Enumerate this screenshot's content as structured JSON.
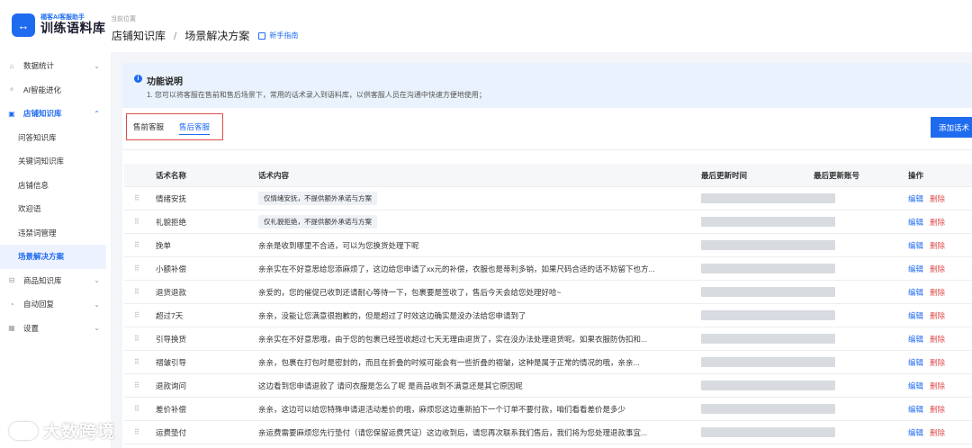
{
  "brand": {
    "subtitle": "福客AI客服助手",
    "title": "训练语料库"
  },
  "sidebar": {
    "items": [
      {
        "name": "nav-data-stats",
        "label": "数据统计",
        "icon": "home-icon",
        "glyph": "⌂",
        "chevron": "⌄"
      },
      {
        "name": "nav-ai-evolution",
        "label": "AI智能进化",
        "icon": "magic-wand-icon",
        "glyph": "✧",
        "chevron": ""
      },
      {
        "name": "nav-store-kb",
        "label": "店铺知识库",
        "icon": "book-icon",
        "glyph": "▣",
        "chevron": "⌃"
      },
      {
        "name": "nav-product-kb",
        "label": "商品知识库",
        "icon": "box-icon",
        "glyph": "⊟",
        "chevron": "⌄"
      },
      {
        "name": "nav-auto-reply",
        "label": "自动回复",
        "icon": "robot-icon",
        "glyph": "◔",
        "chevron": "⌄"
      },
      {
        "name": "nav-settings",
        "label": "设置",
        "icon": "grid-icon",
        "glyph": "▦",
        "chevron": "⌄"
      }
    ],
    "sub_items": [
      "问答知识库",
      "关键词知识库",
      "店铺信息",
      "欢迎语",
      "违禁词管理",
      "场景解决方案"
    ]
  },
  "header": {
    "caption": "当前位置",
    "crumb_root": "店铺知识库",
    "crumb_sep": "/",
    "crumb_current": "场景解决方案",
    "guide_link": "新手指南"
  },
  "info": {
    "icon": "i",
    "title": "功能说明",
    "text": "1. 您可以将客服在售前和售后场景下，常用的话术录入到语料库，以供客服人员在沟通中快速方便地使用；"
  },
  "tabs": [
    {
      "label": "售前客服"
    },
    {
      "label": "售后客服"
    }
  ],
  "add_button": "添加话术",
  "table": {
    "headers": {
      "name": "话术名称",
      "content": "话术内容",
      "time": "最后更新时间",
      "account": "最后更新账号",
      "ops": "操作"
    },
    "edit_label": "编辑",
    "delete_label": "删除",
    "rows": [
      {
        "name": "情绪安抚",
        "content": "仅情绪安抚，不提供额外承诺与方案",
        "tag": true
      },
      {
        "name": "礼貌拒绝",
        "content": "仅礼貌拒绝，不提供额外承诺与方案",
        "tag": true
      },
      {
        "name": "挽单",
        "content": "亲亲是收到哪里不合适，可以为您换货处理下呢",
        "tag": false
      },
      {
        "name": "小额补偿",
        "content": "亲亲实在不好意思给您添麻烦了，这边给您申请了xx元的补偿，衣服也是蒂利多销，如果尺码合适的话不妨留下也方...",
        "tag": false
      },
      {
        "name": "退货退款",
        "content": "亲爱的，您的催促已收到还请耐心等待一下，包裹要是签收了，售后今天会给您处理好哈~",
        "tag": false
      },
      {
        "name": "超过7天",
        "content": "亲亲，没能让您满意很抱歉的，但是超过了时效这边确实是没办法给您申请到了",
        "tag": false
      },
      {
        "name": "引导换货",
        "content": "亲亲实在不好意思哦，由于您的包裹已经签收超过七天无理由退货了，实在没办法处理退货呢。如果衣服防伪扣和...",
        "tag": false
      },
      {
        "name": "褶皱引导",
        "content": "亲亲，包裹在打包时是密封的，而且在折叠的时候可能会有一些折叠的褶皱，这种是属于正常的情况的哦，亲亲...",
        "tag": false
      },
      {
        "name": "退款询问",
        "content": "这边看到您申请退款了 请问衣服是怎么了呢 是商品收到不满意还是其它原因呢",
        "tag": false
      },
      {
        "name": "差价补偿",
        "content": "亲亲，这边可以给您特殊申请退活动差价的哦，麻烦您这边重新拍下一个订单不要付款，咱们看看差价是多少",
        "tag": false
      },
      {
        "name": "运费垫付",
        "content": "亲运费需要麻烦您先行垫付（请您保留运费凭证）这边收到后，请您再次联系我们售后，我们将为您处理退款事宜...",
        "tag": false
      }
    ]
  },
  "watermark": "大数跨境"
}
